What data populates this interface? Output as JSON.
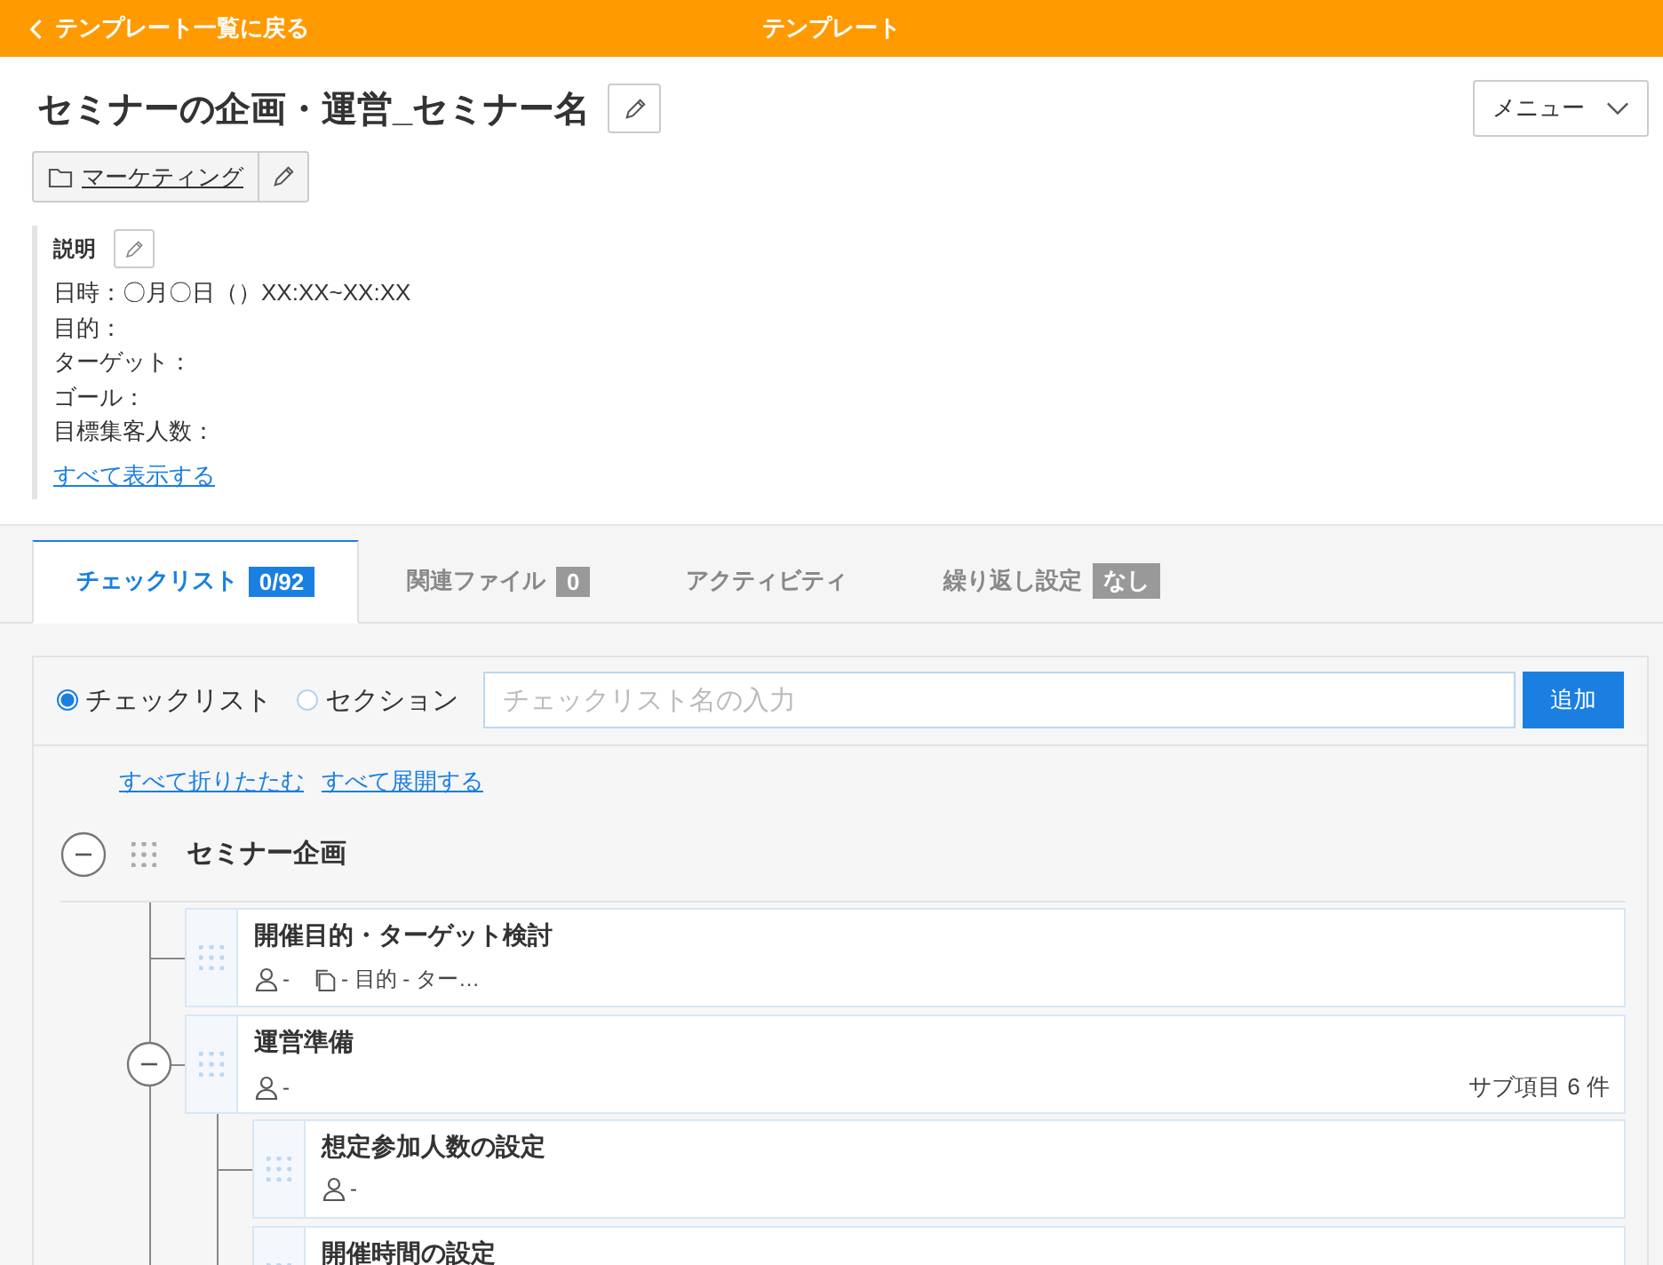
{
  "header": {
    "back_link": "テンプレート一覧に戻る",
    "title": "テンプレート"
  },
  "template": {
    "title": "セミナーの企画・運営_セミナー名",
    "menu_button": "メニュー",
    "folder": "マーケティング"
  },
  "description": {
    "label": "説明",
    "lines": [
      "日時：〇月〇日（）XX:XX~XX:XX",
      "目的：",
      "ターゲット：",
      "ゴール：",
      "目標集客人数："
    ],
    "show_all_link": "すべて表示する"
  },
  "tabs": [
    {
      "label": "チェックリスト",
      "badge": "0/92",
      "selected": true
    },
    {
      "label": "関連ファイル",
      "badge": "0",
      "selected": false
    },
    {
      "label": "アクティビティ",
      "selected": false
    },
    {
      "label": "繰り返し設定",
      "badge": "なし",
      "selected": false
    }
  ],
  "add_form": {
    "types": [
      {
        "label": "チェックリスト",
        "selected": true
      },
      {
        "label": "セクション",
        "selected": false
      }
    ],
    "placeholder": "チェックリスト名の入力",
    "add_button": "追加"
  },
  "tree_links": [
    "すべて折りたたむ",
    "すべて展開する"
  ],
  "checklist": [
    {
      "kind": "section",
      "title": "セミナー企画",
      "expanded": true,
      "children": [
        {
          "kind": "item",
          "title": "開催目的・ターゲット検討",
          "assignee": "-",
          "note": "- 目的 - ター…"
        },
        {
          "kind": "item",
          "title": "運営準備",
          "assignee": "-",
          "expanded": true,
          "sub_count": "サブ項目 6 件",
          "children": [
            {
              "kind": "item",
              "title": "想定参加人数の設定",
              "assignee": "-"
            },
            {
              "kind": "item",
              "title": "開催時間の設定"
            }
          ]
        }
      ]
    }
  ]
}
